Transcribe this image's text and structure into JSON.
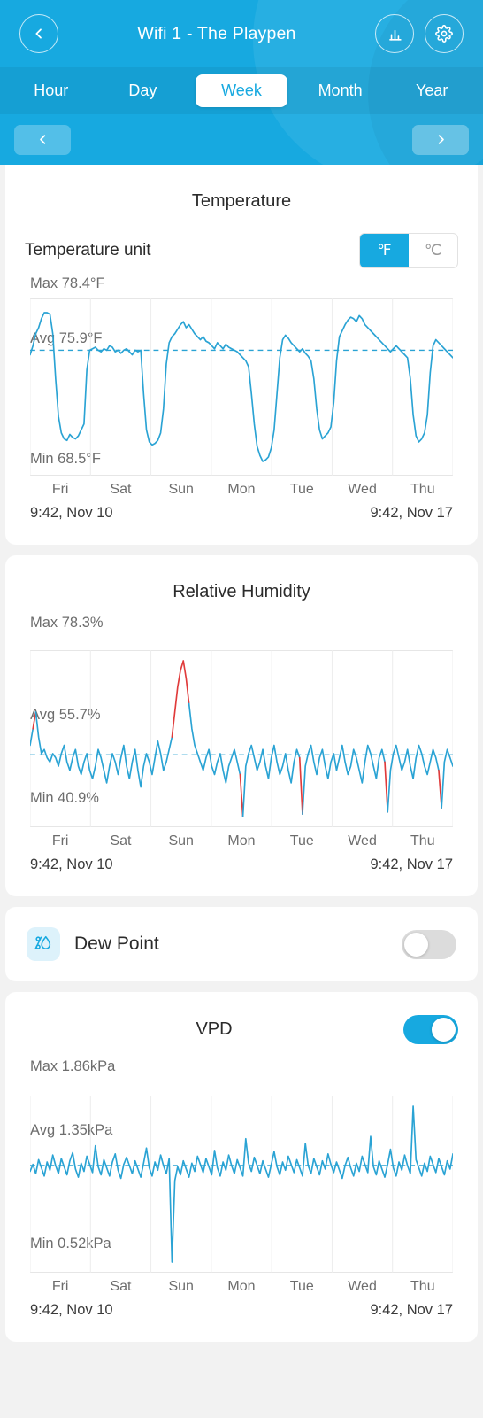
{
  "header": {
    "title": "Wifi 1 - The Playpen",
    "back_icon": "chevron-left-icon",
    "chart_icon": "bar-chart-icon",
    "settings_icon": "gear-icon",
    "prev_icon": "chevron-left-icon",
    "next_icon": "chevron-right-icon",
    "accent_color": "#17a9e0",
    "tabs": [
      {
        "label": "Hour",
        "active": false
      },
      {
        "label": "Day",
        "active": false
      },
      {
        "label": "Week",
        "active": true
      },
      {
        "label": "Month",
        "active": false
      },
      {
        "label": "Year",
        "active": false
      }
    ]
  },
  "temperature": {
    "title": "Temperature",
    "unit_label": "Temperature unit",
    "unit_options": [
      "℉",
      "℃"
    ],
    "unit_selected": "℉",
    "max_label": "Max 78.4°F",
    "avg_label": "Avg 75.9°F",
    "min_label": "Min 68.5°F",
    "range_start": "9:42,  Nov 10",
    "range_end": "9:42,  Nov 17"
  },
  "humidity": {
    "title": "Relative Humidity",
    "max_label": "Max 78.3%",
    "avg_label": "Avg 55.7%",
    "min_label": "Min 40.9%",
    "range_start": "9:42,  Nov 10",
    "range_end": "9:42,  Nov 17"
  },
  "dew_point": {
    "label": "Dew Point",
    "icon": "dew-drop-icon",
    "enabled": false
  },
  "vpd": {
    "title": "VPD",
    "enabled": true,
    "max_label": "Max 1.86kPa",
    "avg_label": "Avg 1.35kPa",
    "min_label": "Min 0.52kPa",
    "range_start": "9:42,  Nov 10",
    "range_end": "9:42,  Nov 17"
  },
  "chart_data": [
    {
      "id": "temperature",
      "type": "line",
      "title": "Temperature",
      "xlabel": "",
      "ylabel": "°F",
      "unit": "°F",
      "grid": true,
      "legend": "none",
      "line_color": "#2aa3d4",
      "avg_line_color": "#2aa3d4",
      "ylim": [
        68.5,
        78.4
      ],
      "max": 78.4,
      "avg": 75.9,
      "min": 68.5,
      "categories": [
        "Fri",
        "Sat",
        "Sun",
        "Mon",
        "Tue",
        "Wed",
        "Thu"
      ],
      "tick_labels": [
        "Fri",
        "Sat",
        "Sun",
        "Mon",
        "Tue",
        "Wed",
        "Thu"
      ],
      "values": [
        75.6,
        76.2,
        77.0,
        77.4,
        78.0,
        78.4,
        78.4,
        78.3,
        77.0,
        74.0,
        71.5,
        70.4,
        70.0,
        69.9,
        70.3,
        70.1,
        70.0,
        70.2,
        70.6,
        71.0,
        74.6,
        75.9,
        76.0,
        76.1,
        75.9,
        75.8,
        76.0,
        75.9,
        76.2,
        76.1,
        75.8,
        75.9,
        75.7,
        75.9,
        76.0,
        75.8,
        75.6,
        75.9,
        75.8,
        75.9,
        73.0,
        70.6,
        69.8,
        69.6,
        69.7,
        69.9,
        70.4,
        72.0,
        75.0,
        76.4,
        76.8,
        77.0,
        77.3,
        77.6,
        77.8,
        77.4,
        77.6,
        77.3,
        77.0,
        76.8,
        76.6,
        76.8,
        76.5,
        76.4,
        76.2,
        76.0,
        76.4,
        76.2,
        76.0,
        76.3,
        76.1,
        76.0,
        75.9,
        75.8,
        75.6,
        75.4,
        75.2,
        74.8,
        73.0,
        71.0,
        69.5,
        68.9,
        68.5,
        68.6,
        68.8,
        69.4,
        70.6,
        73.0,
        75.4,
        76.6,
        76.9,
        76.7,
        76.4,
        76.2,
        76.0,
        75.8,
        76.0,
        75.7,
        75.5,
        75.2,
        74.0,
        72.0,
        70.6,
        70.0,
        70.2,
        70.4,
        70.8,
        72.4,
        75.2,
        76.8,
        77.2,
        77.6,
        77.9,
        78.1,
        78.0,
        77.8,
        78.2,
        78.0,
        77.6,
        77.4,
        77.2,
        77.0,
        76.8,
        76.6,
        76.4,
        76.2,
        76.0,
        75.8,
        76.0,
        76.2,
        76.0,
        75.8,
        75.6,
        75.4,
        74.0,
        71.6,
        70.2,
        69.8,
        70.0,
        70.4,
        71.6,
        74.4,
        76.2,
        76.6,
        76.4,
        76.2,
        76.0,
        75.8,
        75.6,
        75.4
      ]
    },
    {
      "id": "humidity",
      "type": "line",
      "title": "Relative Humidity",
      "xlabel": "",
      "ylabel": "%",
      "unit": "%",
      "grid": true,
      "legend": "none",
      "line_color": "#2aa3d4",
      "alert_color": "#e03b3b",
      "avg_line_color": "#2aa3d4",
      "ylim": [
        40.9,
        78.3
      ],
      "max": 78.3,
      "avg": 55.7,
      "min": 40.9,
      "categories": [
        "Fri",
        "Sat",
        "Sun",
        "Mon",
        "Tue",
        "Wed",
        "Thu"
      ],
      "tick_labels": [
        "Fri",
        "Sat",
        "Sun",
        "Mon",
        "Tue",
        "Wed",
        "Thu"
      ],
      "note": "Red segments mark out-of-range excursions; large red spike near Sat/Sun peaks at 78.3%",
      "values": [
        58.0,
        62.0,
        66.0,
        60.0,
        56.0,
        57.0,
        55.0,
        54.0,
        56.0,
        55.0,
        53.0,
        56.0,
        58.0,
        54.0,
        52.0,
        55.0,
        57.0,
        53.0,
        51.0,
        54.0,
        56.0,
        52.0,
        50.0,
        53.0,
        57.0,
        55.0,
        52.0,
        49.0,
        53.0,
        56.0,
        54.0,
        51.0,
        55.0,
        58.0,
        53.0,
        50.0,
        54.0,
        57.0,
        52.0,
        48.0,
        53.0,
        56.0,
        54.0,
        51.0,
        55.0,
        59.0,
        56.0,
        52.0,
        54.0,
        57.0,
        60.0,
        66.0,
        72.0,
        76.0,
        78.3,
        74.0,
        68.0,
        62.0,
        58.0,
        56.0,
        54.0,
        52.0,
        55.0,
        57.0,
        53.0,
        51.0,
        54.0,
        56.0,
        52.0,
        49.0,
        53.0,
        55.0,
        57.0,
        54.0,
        51.0,
        40.9,
        53.0,
        56.0,
        58.0,
        55.0,
        52.0,
        54.0,
        57.0,
        53.0,
        50.0,
        55.0,
        58.0,
        54.0,
        51.0,
        53.0,
        56.0,
        52.0,
        49.0,
        54.0,
        57.0,
        55.0,
        41.5,
        53.0,
        56.0,
        58.0,
        54.0,
        51.0,
        55.0,
        57.0,
        53.0,
        50.0,
        54.0,
        56.0,
        52.0,
        55.0,
        58.0,
        54.0,
        51.0,
        53.0,
        57.0,
        55.0,
        52.0,
        49.0,
        54.0,
        58.0,
        56.0,
        53.0,
        50.0,
        55.0,
        57.0,
        54.0,
        42.0,
        52.0,
        56.0,
        58.0,
        55.0,
        52.0,
        54.0,
        57.0,
        53.0,
        50.0,
        55.0,
        58.0,
        56.0,
        53.0,
        51.0,
        54.0,
        57.0,
        55.0,
        52.0,
        43.0,
        54.0,
        57.0,
        55.0,
        53.0
      ]
    },
    {
      "id": "vpd",
      "type": "line",
      "title": "VPD",
      "xlabel": "",
      "ylabel": "kPa",
      "unit": "kPa",
      "grid": true,
      "legend": "none",
      "line_color": "#2aa3d4",
      "avg_line_color": "#2aa3d4",
      "ylim": [
        0.52,
        1.86
      ],
      "max": 1.86,
      "avg": 1.35,
      "min": 0.52,
      "categories": [
        "Fri",
        "Sat",
        "Sun",
        "Mon",
        "Tue",
        "Wed",
        "Thu"
      ],
      "tick_labels": [
        "Fri",
        "Sat",
        "Sun",
        "Mon",
        "Tue",
        "Wed",
        "Thu"
      ],
      "note": "Deep single dip to 0.52kPa just before Sun",
      "values": [
        1.3,
        1.36,
        1.28,
        1.4,
        1.33,
        1.26,
        1.38,
        1.31,
        1.44,
        1.35,
        1.28,
        1.41,
        1.34,
        1.27,
        1.39,
        1.46,
        1.32,
        1.25,
        1.37,
        1.3,
        1.43,
        1.36,
        1.29,
        1.52,
        1.34,
        1.27,
        1.4,
        1.33,
        1.26,
        1.38,
        1.45,
        1.31,
        1.24,
        1.36,
        1.42,
        1.35,
        1.28,
        1.39,
        1.32,
        1.25,
        1.37,
        1.5,
        1.33,
        1.26,
        1.38,
        1.31,
        1.44,
        1.35,
        1.28,
        1.41,
        0.52,
        1.22,
        1.34,
        1.27,
        1.39,
        1.32,
        1.25,
        1.37,
        1.3,
        1.43,
        1.36,
        1.29,
        1.41,
        1.34,
        1.27,
        1.48,
        1.33,
        1.26,
        1.38,
        1.31,
        1.44,
        1.35,
        1.28,
        1.4,
        1.33,
        1.26,
        1.58,
        1.37,
        1.3,
        1.42,
        1.35,
        1.28,
        1.39,
        1.32,
        1.25,
        1.36,
        1.47,
        1.34,
        1.27,
        1.38,
        1.31,
        1.43,
        1.36,
        1.29,
        1.4,
        1.33,
        1.26,
        1.54,
        1.35,
        1.28,
        1.41,
        1.34,
        1.27,
        1.39,
        1.32,
        1.45,
        1.36,
        1.29,
        1.38,
        1.31,
        1.24,
        1.35,
        1.42,
        1.33,
        1.26,
        1.37,
        1.3,
        1.43,
        1.36,
        1.29,
        1.6,
        1.34,
        1.27,
        1.39,
        1.32,
        1.25,
        1.36,
        1.49,
        1.33,
        1.26,
        1.38,
        1.31,
        1.44,
        1.35,
        1.28,
        1.86,
        1.4,
        1.33,
        1.26,
        1.37,
        1.3,
        1.43,
        1.36,
        1.29,
        1.41,
        1.34,
        1.27,
        1.39,
        1.32,
        1.45
      ]
    }
  ]
}
